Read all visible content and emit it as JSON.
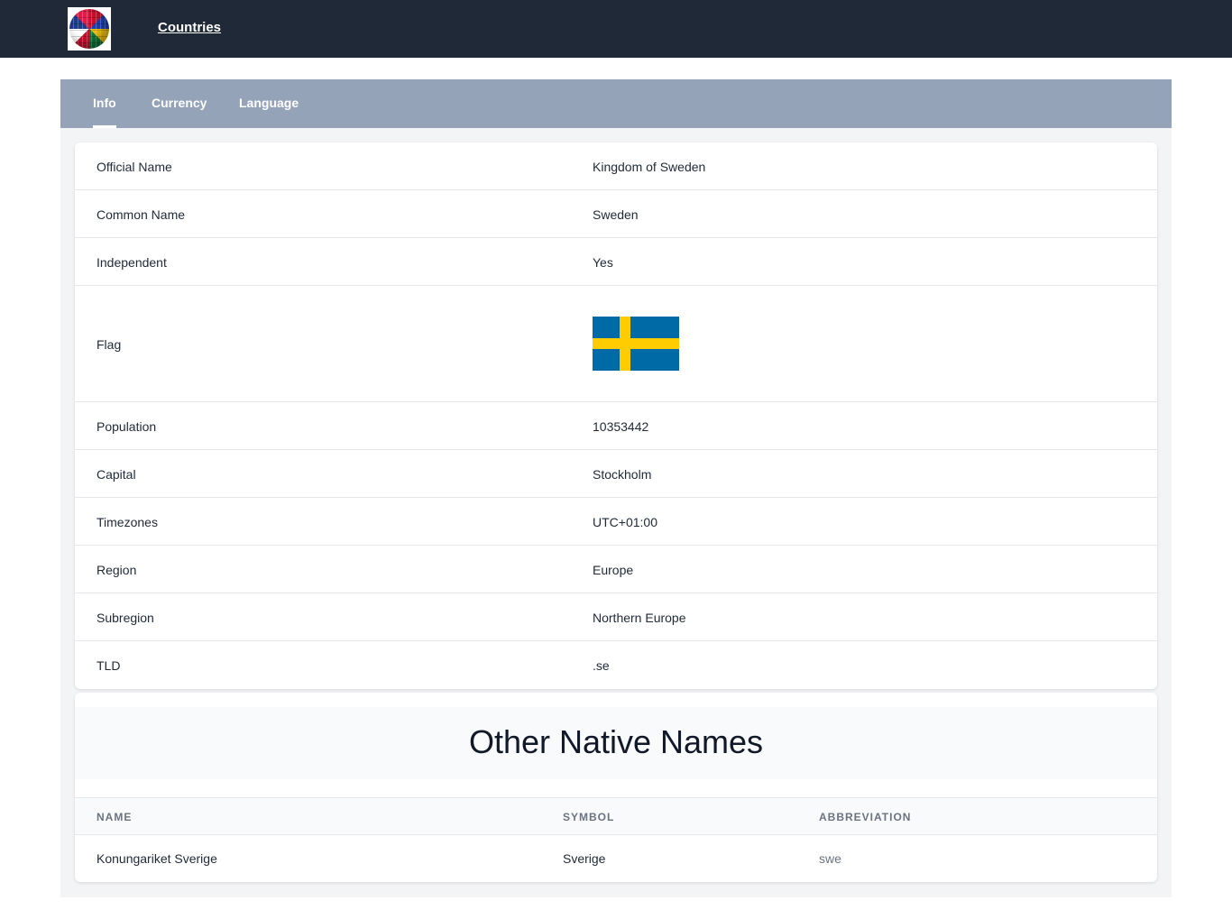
{
  "header": {
    "nav_link": "Countries",
    "logo_icon": "world-flags-globe-icon"
  },
  "tabs": [
    {
      "label": "Info",
      "active": true
    },
    {
      "label": "Currency",
      "active": false
    },
    {
      "label": "Language",
      "active": false
    }
  ],
  "info": {
    "rows": [
      {
        "label": "Official Name",
        "value": "Kingdom of Sweden"
      },
      {
        "label": "Common Name",
        "value": "Sweden"
      },
      {
        "label": "Independent",
        "value": "Yes"
      },
      {
        "label": "Flag",
        "value": "",
        "flag_colors": {
          "field": "#006aa7",
          "cross": "#fecc00"
        }
      },
      {
        "label": "Population",
        "value": "10353442"
      },
      {
        "label": "Capital",
        "value": "Stockholm"
      },
      {
        "label": "Timezones",
        "value": "UTC+01:00"
      },
      {
        "label": "Region",
        "value": "Europe"
      },
      {
        "label": "Subregion",
        "value": "Northern Europe"
      },
      {
        "label": "TLD",
        "value": ".se"
      }
    ]
  },
  "native_names": {
    "title": "Other Native Names",
    "columns": [
      "NAME",
      "SYMBOL",
      "ABBREVIATION"
    ],
    "rows": [
      {
        "name": "Konungariket Sverige",
        "symbol": "Sverige",
        "abbreviation": "swe"
      }
    ]
  },
  "colors": {
    "header_bg": "#1f2937",
    "tabbar_bg": "#94a3b8",
    "panel_bg": "#f3f4f6"
  }
}
